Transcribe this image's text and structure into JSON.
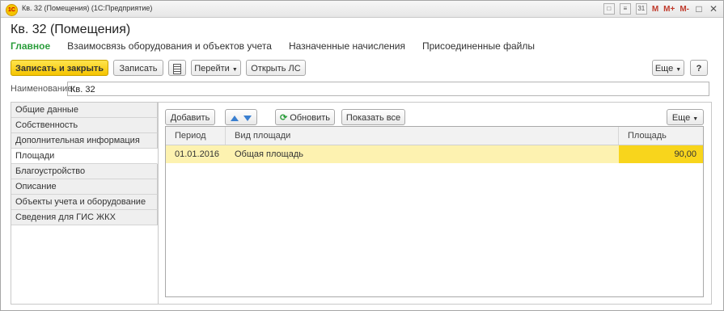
{
  "window": {
    "title": "Кв. 32 (Помещения)  (1С:Предприятие)",
    "logo_text": "1С"
  },
  "titlebar_icons": [
    "save-icon",
    "list-icon",
    "calendar-icon"
  ],
  "titlebar_memory": [
    "M",
    "M+",
    "M-"
  ],
  "titlebar_controls": {
    "restore": "□",
    "close": "✕"
  },
  "form": {
    "title": "Кв. 32 (Помещения)"
  },
  "nav": {
    "tabs": [
      {
        "label": "Главное",
        "active": true
      },
      {
        "label": "Взаимосвязь оборудования и объектов учета",
        "active": false
      },
      {
        "label": "Назначенные начисления",
        "active": false
      },
      {
        "label": "Присоединенные файлы",
        "active": false
      }
    ]
  },
  "toolbar": {
    "save_close": "Записать и закрыть",
    "save": "Записать",
    "goto": "Перейти",
    "open_account": "Открыть ЛС",
    "more": "Еще",
    "help": "?"
  },
  "name_field": {
    "label": "Наименование:",
    "value": "Кв. 32"
  },
  "sidebar": {
    "items": [
      {
        "label": "Общие данные",
        "active": false
      },
      {
        "label": "Собственность",
        "active": false
      },
      {
        "label": "Дополнительная информация",
        "active": false
      },
      {
        "label": "Площади",
        "active": true
      },
      {
        "label": "Благоустройство",
        "active": false
      },
      {
        "label": "Описание",
        "active": false
      },
      {
        "label": "Объекты учета и оборудование",
        "active": false
      },
      {
        "label": "Сведения для ГИС ЖКХ",
        "active": false
      }
    ]
  },
  "areas_toolbar": {
    "add": "Добавить",
    "refresh": "Обновить",
    "show_all": "Показать все",
    "more": "Еще"
  },
  "table": {
    "columns": [
      "Период",
      "Вид площади",
      "Площадь"
    ],
    "rows": [
      {
        "period": "01.01.2016",
        "type": "Общая площадь",
        "area": "90,00"
      }
    ]
  },
  "colors": {
    "accent_green": "#2a9d3b",
    "primary_yellow": "#f5c400",
    "row_highlight": "#fdf2b0"
  }
}
